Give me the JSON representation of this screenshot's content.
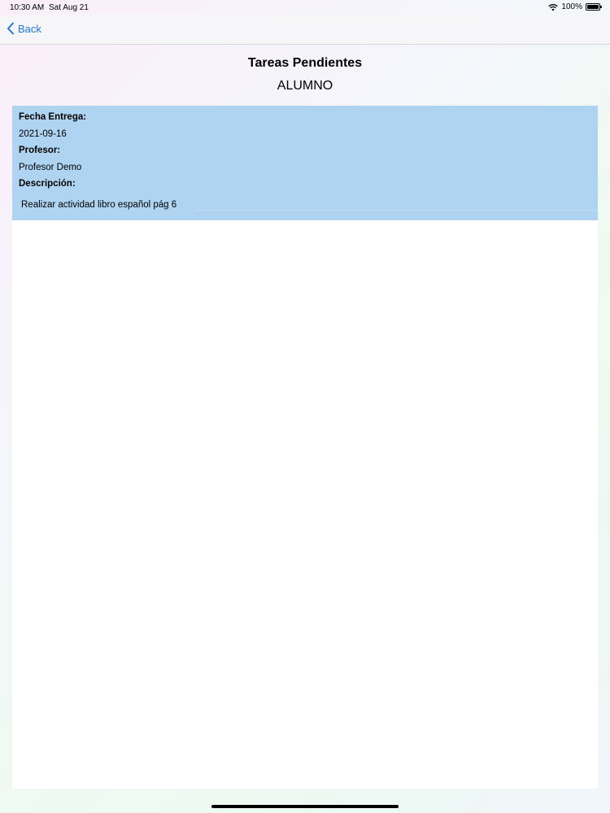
{
  "status_bar": {
    "time": "10:30 AM",
    "date": "Sat Aug 21",
    "battery": "100%",
    "icons": [
      "wifi-icon",
      "battery-icon"
    ]
  },
  "nav": {
    "back_label": "Back",
    "accent_color": "#1f7ad6"
  },
  "header": {
    "title": "Tareas Pendientes",
    "subtitle": "ALUMNO"
  },
  "task": {
    "card_color": "#aed4f1",
    "fecha_label": "Fecha Entrega:",
    "fecha_value": "2021-09-16",
    "profesor_label": "Profesor:",
    "profesor_value": "Profesor Demo",
    "descripcion_label": "Descripción:",
    "descripcion_value": "Realizar actividad libro español pág 6"
  }
}
